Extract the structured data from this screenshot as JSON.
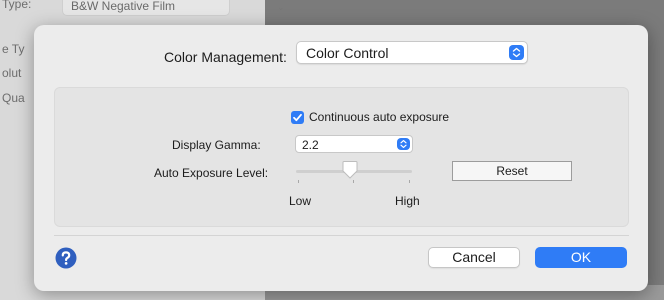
{
  "background_window": {
    "type_label": "Type:",
    "type_value": "B&W Negative Film",
    "left_labels": [
      "e Ty",
      "olut",
      "Qua"
    ]
  },
  "dialog": {
    "color_management_label": "Color Management:",
    "color_management_value": "Color Control",
    "continuous_auto_exposure_label": "Continuous auto exposure",
    "continuous_auto_exposure_checked": true,
    "display_gamma_label": "Display Gamma:",
    "display_gamma_value": "2.2",
    "auto_exposure_level_label": "Auto Exposure Level:",
    "auto_exposure_level_fraction": 0.45,
    "reset_label": "Reset",
    "low_label": "Low",
    "high_label": "High",
    "cancel_label": "Cancel",
    "ok_label": "OK"
  },
  "colors": {
    "accent": "#2f7cf6",
    "sheet_bg": "#ececec",
    "group_bg": "#e4e4e4"
  },
  "icons": [
    "chevron-updown-icon",
    "checkmark-icon",
    "help-icon",
    "slider-thumb"
  ]
}
